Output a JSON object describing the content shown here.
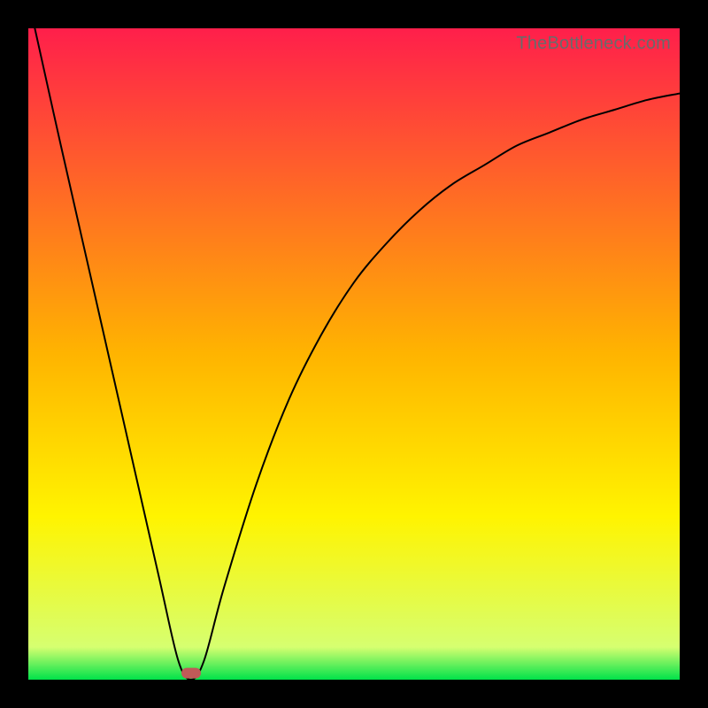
{
  "watermark": "TheBottleneck.com",
  "chart_data": {
    "type": "line",
    "title": "",
    "xlabel": "",
    "ylabel": "",
    "xlim": [
      0,
      100
    ],
    "ylim": [
      0,
      100
    ],
    "background_gradient": {
      "stops": [
        {
          "pct": 0,
          "color": "#ff1f4b"
        },
        {
          "pct": 50,
          "color": "#ffb400"
        },
        {
          "pct": 75,
          "color": "#fff400"
        },
        {
          "pct": 95,
          "color": "#d6ff70"
        },
        {
          "pct": 100,
          "color": "#00e24a"
        }
      ]
    },
    "series": [
      {
        "name": "curve",
        "color": "#000000",
        "stroke_width": 2,
        "x": [
          1,
          5,
          10,
          15,
          20,
          23,
          25,
          27,
          30,
          35,
          40,
          45,
          50,
          55,
          60,
          65,
          70,
          75,
          80,
          85,
          90,
          95,
          100
        ],
        "y": [
          100,
          82,
          60,
          38,
          16,
          3,
          0,
          3,
          14,
          30,
          43,
          53,
          61,
          67,
          72,
          76,
          79,
          82,
          84,
          86,
          87.5,
          89,
          90
        ]
      }
    ],
    "marker": {
      "x": 25,
      "y": 1,
      "color": "#c05a58"
    }
  }
}
